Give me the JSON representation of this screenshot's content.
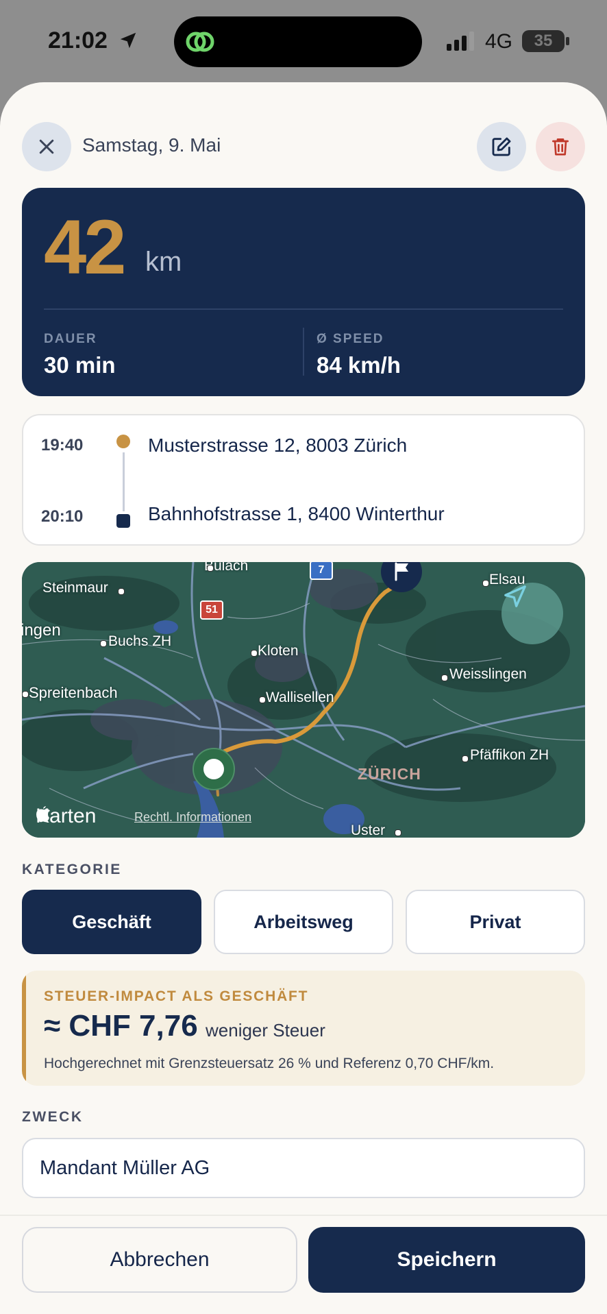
{
  "status_bar": {
    "time": "21:02",
    "network": "4G",
    "battery": "35"
  },
  "header": {
    "date": "Samstag, 9. Mai"
  },
  "trip": {
    "distance_value": "42",
    "distance_unit": "km",
    "duration_label": "DAUER",
    "duration_value": "30 min",
    "speed_label": "Ø SPEED",
    "speed_value": "84 km/h"
  },
  "route": {
    "start_time": "19:40",
    "start_address": "Musterstrasse 12, 8003 Zürich",
    "end_time": "20:10",
    "end_address": "Bahnhofstrasse 1, 8400 Winterthur"
  },
  "map": {
    "labels": [
      "Bülach",
      "Steinmaur",
      "ingen",
      "Buchs ZH",
      "Kloten",
      "Spreitenbach",
      "Wallisellen",
      "Weisslingen",
      "Elsau",
      "Pfäffikon ZH",
      "Uster"
    ],
    "region_label": "ZÜRICH",
    "road_badges": [
      "51",
      "7"
    ],
    "attribution": "Karten",
    "legal_link": "Rechtl. Informationen",
    "route_color": "#d99a3a"
  },
  "category": {
    "section_label": "KATEGORIE",
    "options": [
      "Geschäft",
      "Arbeitsweg",
      "Privat"
    ],
    "selected": "Geschäft"
  },
  "tax": {
    "title": "STEUER-IMPACT ALS GESCHÄFT",
    "amount": "≈ CHF 7,76",
    "suffix": "weniger Steuer",
    "note": "Hochgerechnet mit Grenzsteuersatz 26 % und Referenz 0,70 CHF/km."
  },
  "purpose": {
    "section_label": "ZWECK",
    "value": "Mandant Müller AG"
  },
  "footer": {
    "cancel_label": "Abbrechen",
    "save_label": "Speichern"
  },
  "colors": {
    "navy": "#162a4d",
    "accent": "#c89344",
    "background": "#faf8f4"
  }
}
